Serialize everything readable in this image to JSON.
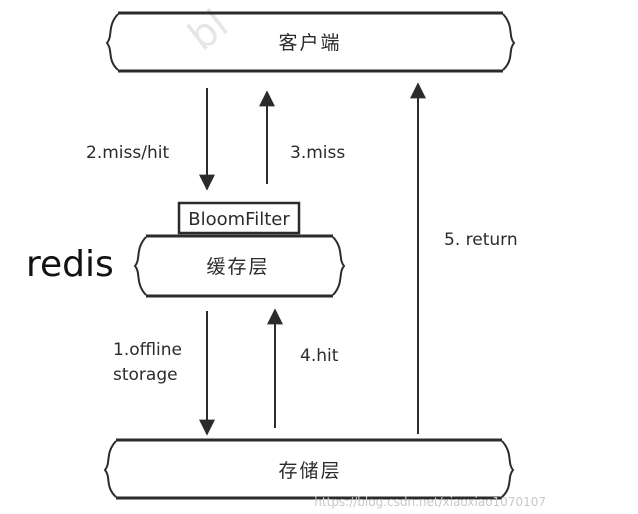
{
  "diagram": {
    "client_layer": {
      "label": "客户端"
    },
    "cache_layer": {
      "label": "缓存层",
      "filter_label": "BloomFilter",
      "side_label": "redis"
    },
    "storage_layer": {
      "label": "存储层"
    },
    "edges": {
      "miss_hit": "2.miss/hit",
      "miss": "3.miss",
      "offline_line1": "1.offline",
      "offline_line2": "storage",
      "hit": "4.hit",
      "return": "5. return"
    }
  },
  "watermark": {
    "upper": "bl",
    "lower": "https://blog.csdn.net/xiaoxiao1070107"
  }
}
